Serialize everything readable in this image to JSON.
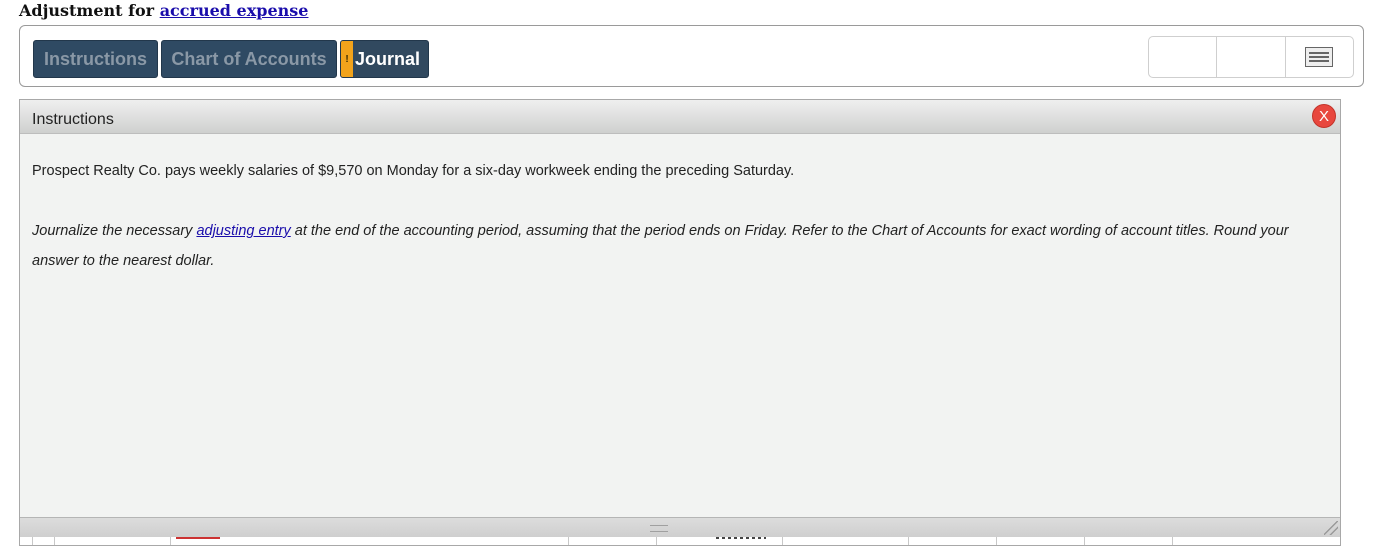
{
  "heading": {
    "prefix": "Adjustment for",
    "link": "accrued expense"
  },
  "tabs": [
    {
      "label": "Instructions",
      "active": false
    },
    {
      "label": "Chart of Accounts",
      "active": false
    },
    {
      "label": "Journal",
      "active": true,
      "flag": "!"
    }
  ],
  "tools": [
    "",
    "",
    "menu-icon"
  ],
  "panel": {
    "title": "Instructions",
    "close_label": "X",
    "paragraph1": "Prospect Realty Co. pays weekly salaries of $9,570 on Monday for a six-day workweek ending the preceding Saturday.",
    "paragraph2_before": "Journalize the necessary",
    "paragraph2_link": "adjusting entry",
    "paragraph2_after": " at the end of the accounting period, assuming that the period ends on Friday. Refer to the Chart of Accounts for exact wording of account titles. Round your answer to the nearest dollar."
  },
  "colors": {
    "tab_bg": "#2f4a63",
    "flag": "#f2a31b",
    "close": "#e8473e",
    "panel_bg": "#f2f3f2",
    "link": "#1a0dab"
  }
}
